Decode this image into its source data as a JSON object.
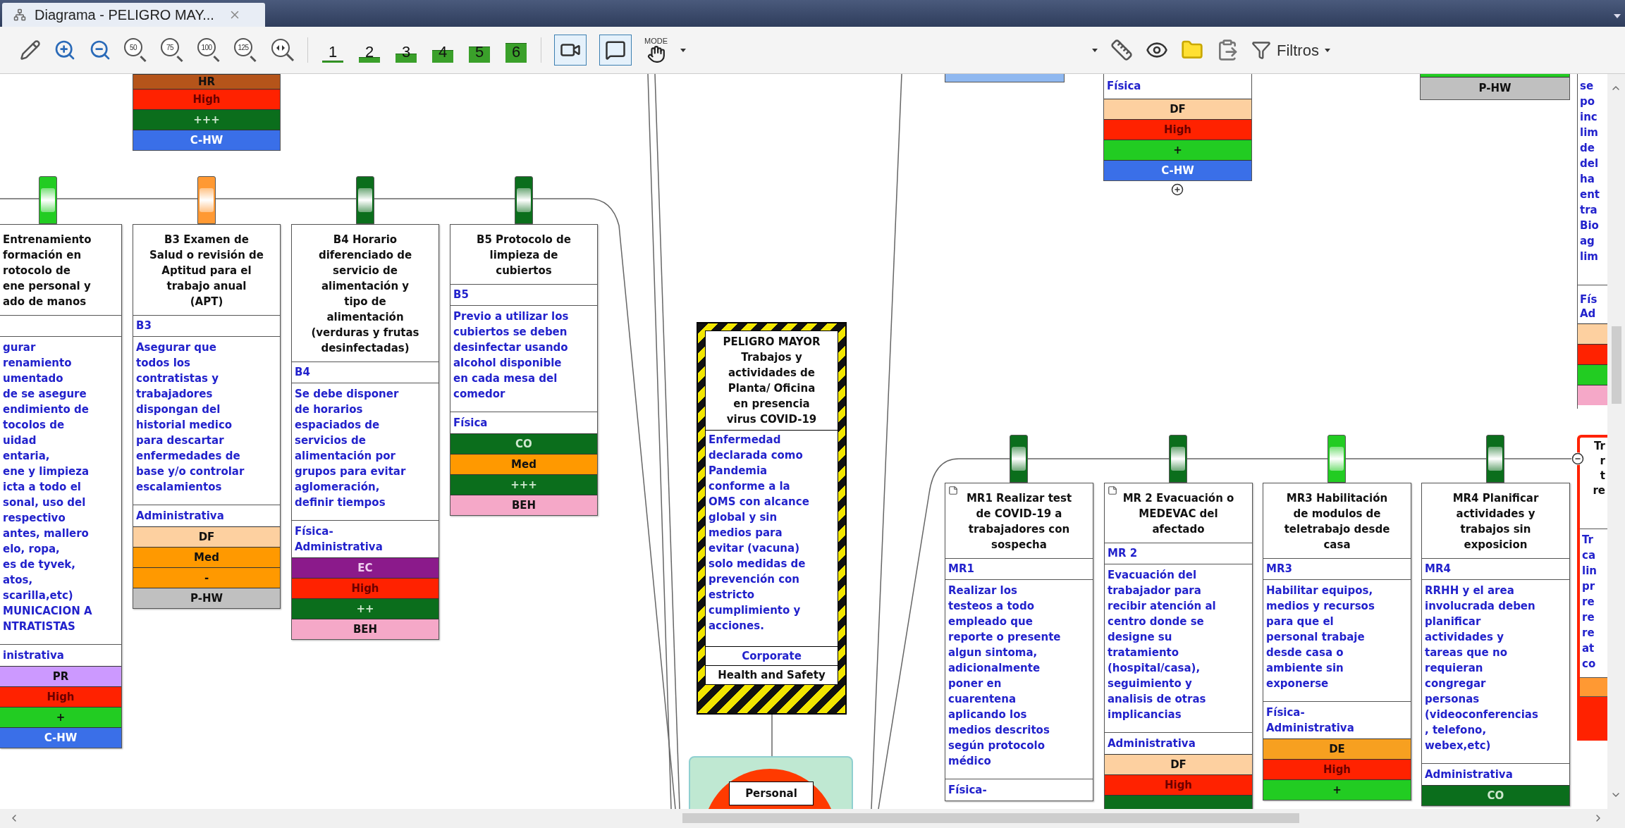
{
  "tab": {
    "title": "Diagrama - PELIGRO MAY..."
  },
  "toolbar": {
    "zoom_presets": [
      "50",
      "75",
      "100",
      "125"
    ],
    "level_buttons": [
      "1",
      "2",
      "3",
      "4",
      "5",
      "6"
    ],
    "toggles": [
      {
        "kind": "camera",
        "selected": true
      },
      {
        "kind": "comment",
        "selected": true
      }
    ],
    "mode_label": "MODE",
    "filter_label": "Filtros"
  },
  "top_left_ratings": [
    {
      "label": "HR",
      "color": "#b5541a"
    },
    {
      "label": "High",
      "color": "#ff2200"
    },
    {
      "label": "+++",
      "color": "#0b6e1c"
    },
    {
      "label": "C-HW",
      "color": "#3a6fe8"
    }
  ],
  "threat_barriers": [
    {
      "title": "Entrenamiento\nformación en\nrotocolo de\nene personal y\nado de manos",
      "description": "gurar\nrenamiento\numentado\nde se asegure\nendimiento de\ntocolos de\nuidad\nentaria,\nene y limpieza\nicta a todo el\nsonal, uso del\nrespectivo\nantes, mallero\nelo, ropa,\nes de tyvek,\natos,\nscarilla,etc)\nMUNICACION A\nNTRATISTAS",
      "category": "inistrativa",
      "color": "#22cc22",
      "ratings": [
        {
          "label": "PR",
          "color": "#cc99ff"
        },
        {
          "label": "High",
          "color": "#ff2200"
        },
        {
          "label": "+",
          "color": "#22cc22"
        },
        {
          "label": "C-HW",
          "color": "#3a6fe8"
        }
      ]
    },
    {
      "title": "B3 Examen de\nSalud o revisión de\nAptitud para el\ntrabajo anual\n(APT)",
      "code": "B3",
      "description": "Asegurar que\ntodos los\ncontratistas y\ntrabajadores\ndispongan del\nhistorial medico\npara descartar\nenfermedades de\nbase y/o controlar\nescalamientos",
      "category": "Administrativa",
      "color": "#ff9933",
      "ratings": [
        {
          "label": "DF",
          "color": "#fdd0a0"
        },
        {
          "label": "Med",
          "color": "#ff9900"
        },
        {
          "label": "-",
          "color": "#ff9900"
        },
        {
          "label": "P-HW",
          "color": "#c0c0c0"
        }
      ]
    },
    {
      "title": "B4 Horario\ndiferenciado de\nservicio de\nalimentación y\ntipo de\nalimentación\n(verduras y frutas\ndesinfectadas)",
      "code": "B4",
      "description": "Se debe disponer\nde horarios\nespaciados de\nservicios de\nalimentación por\ngrupos para evitar\naglomeración,\ndefinir tiempos",
      "category": "Física-\nAdministrativa",
      "color": "#0b6e1c",
      "ratings": [
        {
          "label": "EC",
          "color": "#8b1a8b"
        },
        {
          "label": "High",
          "color": "#ff2200"
        },
        {
          "label": "++",
          "color": "#0b6e1c"
        },
        {
          "label": "BEH",
          "color": "#f5a8c8"
        }
      ]
    },
    {
      "title": "B5 Protocolo de\nlimpieza de\ncubiertos",
      "code": "B5",
      "description": "Previo a utilizar los\ncubiertos se deben\ndesinfectar usando\nalcohol disponible\nen cada mesa del\ncomedor",
      "category": "Física",
      "color": "#0b6e1c",
      "ratings": [
        {
          "label": "CO",
          "color": "#0b6e1c"
        },
        {
          "label": "Med",
          "color": "#ff9900"
        },
        {
          "label": "+++",
          "color": "#0b6e1c"
        },
        {
          "label": "BEH",
          "color": "#f5a8c8"
        }
      ]
    }
  ],
  "hazard": {
    "title": "PELIGRO MAYOR\nTrabajos y\nactividades de\nPlanta/ Oficina\nen presencia\nvirus COVID-19",
    "description": "Enfermedad\ndeclarada como\nPandemia\nconforme a la\nOMS con alcance\nglobal y sin\nmedios para\nevitar (vacuna)\nsolo medidas de\nprevención con\nestricto\ncumplimiento y\nacciones.",
    "owner": "Corporate",
    "category": "Health and Safety"
  },
  "top_event": {
    "label": "Personal"
  },
  "top_right_box": {
    "category": "Física",
    "ratings": [
      {
        "label": "DF",
        "color": "#fdd0a0"
      },
      {
        "label": "High",
        "color": "#ff2200"
      },
      {
        "label": "+",
        "color": "#22cc22"
      },
      {
        "label": "C-HW",
        "color": "#3a6fe8"
      }
    ]
  },
  "p_hw_box": {
    "ratings": [
      {
        "label": "P-HW",
        "color": "#c0c0c0"
      }
    ]
  },
  "edge_node_top": {
    "lines": "se\npo\ninc\nlim\nde\ndel\nha\nent\ntra\nBio\nag\nlim",
    "category": "Fís\nAd",
    "ratings": [
      {
        "color": "#fdd0a0"
      },
      {
        "color": "#ff2200"
      },
      {
        "color": "#22cc22"
      },
      {
        "color": "#f5a8c8"
      }
    ]
  },
  "edge_node_mid": {
    "title": "Tr\nr\nt\nre",
    "description": "Tr\nca\nlin\npr\nre\nre\nre\nat\nco"
  },
  "consequence_barriers": [
    {
      "title": "MR1 Realizar test\nde COVID-19 a\ntrabajadores con\nsospecha",
      "has_note": true,
      "code": "MR1",
      "description": "Realizar los\ntesteos a todo\nempleado que\nreporte o presente\nalgun sintoma,\nadicionalmente\nponer en\ncuarentena\naplicando los\nmedios descritos\nsegún protocolo\nmédico",
      "category": "Física-",
      "color": "#0b6e1c"
    },
    {
      "title": "MR 2 Evacuación o\nMEDEVAC del\nafectado",
      "has_note": true,
      "code": "MR 2",
      "description": "Evacuación del\ntrabajador para\nrecibir atención al\ncentro donde se\ndesigne su\ntratamiento\n(hospital/casa),\nseguimiento y\nanalisis de otras\nimplicancias",
      "category": "Administrativa",
      "color": "#0b6e1c",
      "ratings": [
        {
          "label": "DF",
          "color": "#fdd0a0"
        },
        {
          "label": "High",
          "color": "#ff2200"
        },
        {
          "color": "#0b6e1c"
        }
      ]
    },
    {
      "title": "MR3 Habilitación\nde modulos de\nteletrabajo desde\ncasa",
      "has_note": false,
      "code": "MR3",
      "description": "Habilitar equipos,\nmedios y recursos\npara que el\npersonal trabaje\ndesde casa o\nambiente sin\nexponerse",
      "category": "Física-\nAdministrativa",
      "color": "#22cc22",
      "ratings": [
        {
          "label": "DE",
          "color": "#f7a020"
        },
        {
          "label": "High",
          "color": "#ff2200"
        },
        {
          "label": "+",
          "color": "#22cc22"
        }
      ]
    },
    {
      "title": "MR4 Planificar\nactividades y\ntrabajos sin\nexposicion",
      "has_note": false,
      "code": "MR4",
      "description": "RRHH y el area\ninvolucrada deben\nplanificar\nactividades y\ntareas que no\nrequieran\ncongregar\npersonas\n(videoconferencias\n, telefono,\nwebex,etc)",
      "category": "Administrativa",
      "color": "#0b6e1c",
      "ratings": [
        {
          "label": "CO",
          "color": "#0b6e1c"
        }
      ]
    }
  ]
}
